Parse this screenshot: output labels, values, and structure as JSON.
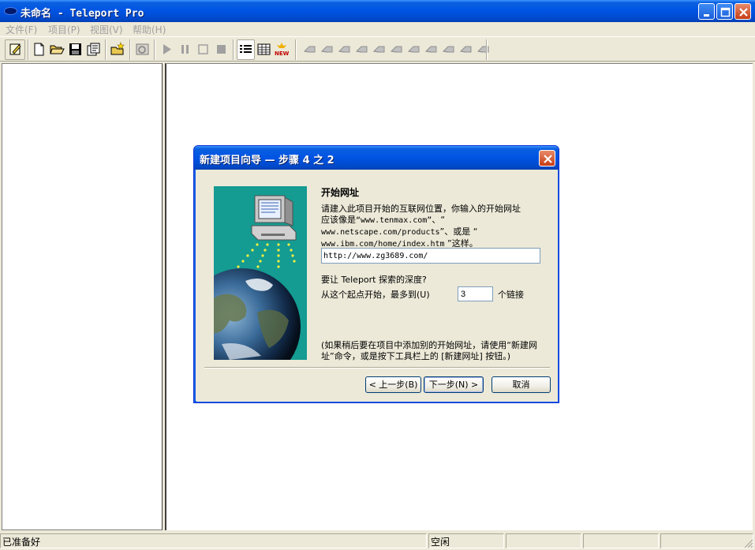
{
  "window": {
    "title": "未命名 - Teleport Pro"
  },
  "menu": {
    "items": [
      "文件(F)",
      "项目(P)",
      "视图(V)",
      "帮助(H)"
    ]
  },
  "toolbar": {
    "buttons": [
      "edit-icon",
      "new-file-icon",
      "open-folder-icon",
      "save-icon",
      "properties-icon",
      "new-project-icon",
      "browse-icon",
      "play-icon",
      "pause-icon",
      "stop-icon",
      "stop-square-icon",
      "list-view-icon",
      "table-view-icon",
      "new-address-icon"
    ],
    "bookmark_count": 11
  },
  "dialog": {
    "title": "新建项目向导 — 步骤 4 之 2",
    "heading": "开始网址",
    "desc_line1": "请建入此项目开始的互联网位置，你输入的开始网址",
    "desc_line2_prefix": "应该像是",
    "desc_example1": "“www.tenmax.com”",
    "desc_line2_suffix": "、“",
    "desc_example2": "www.netscape.com/products",
    "desc_line3_suffix": "”、或是 “",
    "desc_example3": "www.ibm.com/home/index.htm",
    "desc_line4_suffix": " ”这样。",
    "url_value": "http://www.zg3689.com/",
    "depth_question": "要让 Teleport 探索的深度?",
    "depth_label": "从这个起点开始，最多到(U)",
    "depth_value": "3",
    "depth_unit": "个链接",
    "hint": "(如果稍后要在项目中添加别的开始网址，请使用“新建网址”命令，或是按下工具栏上的 [新建网址] 按钮。)",
    "back_label": "< 上一步(B)",
    "next_label": "下一步(N) >",
    "cancel_label": "取消"
  },
  "statusbar": {
    "message": "已准备好",
    "state": "空闲"
  }
}
